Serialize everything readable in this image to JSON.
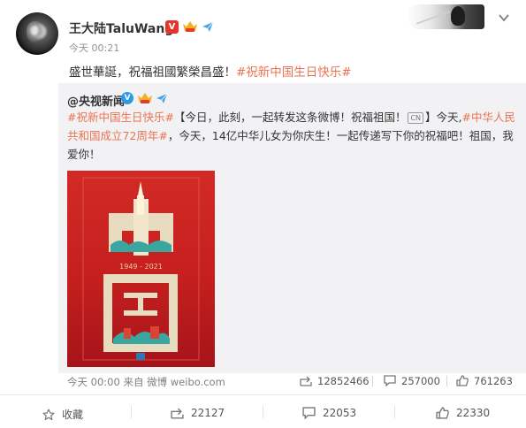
{
  "post": {
    "username": "王大陆TaluWang",
    "time": "今天 00:21",
    "text_plain": "盛世華誕，祝福祖國繁榮昌盛！",
    "text_hashtag": "#祝新中国生日快乐#"
  },
  "repost": {
    "username": "@央视新闻",
    "text_hashtag1": "#祝新中国生日快乐#",
    "text_part1": "【今日，此刻，一起转发这条微博！祝福祖国！",
    "cn_tag": "CN",
    "text_part2": "】今天,",
    "text_hashtag2": "#中华人民共和国成立72周年#",
    "text_part3": "，今天，14亿中华儿女为你庆生！一起传递写下你的祝福吧！祖国，我爱你！",
    "poster": {
      "char1": "中",
      "char2": "国",
      "years": "1949 - 2021"
    },
    "footer": {
      "time": "今天 00:00",
      "source_prefix": "来自",
      "source": "微博 weibo.com"
    },
    "stats": {
      "reposts": "12852466",
      "comments": "257000",
      "likes": "761263"
    }
  },
  "actions": {
    "favorite_label": "收藏",
    "repost_count": "22127",
    "comment_count": "22053",
    "like_count": "22330"
  },
  "colors": {
    "hashtag": "#eb7350",
    "poster_red": "#c51f1e",
    "repost_bg": "#f2f2f5",
    "muted_text": "#939393"
  },
  "icons": {
    "verified": "verified-v-icon",
    "vip": "crown-vip-icon",
    "client": "paper-plane-icon",
    "menu": "chevron-down-icon",
    "repost": "repost-arrow-icon",
    "comment": "comment-bubble-icon",
    "like": "thumbs-up-icon",
    "favorite": "star-icon"
  }
}
